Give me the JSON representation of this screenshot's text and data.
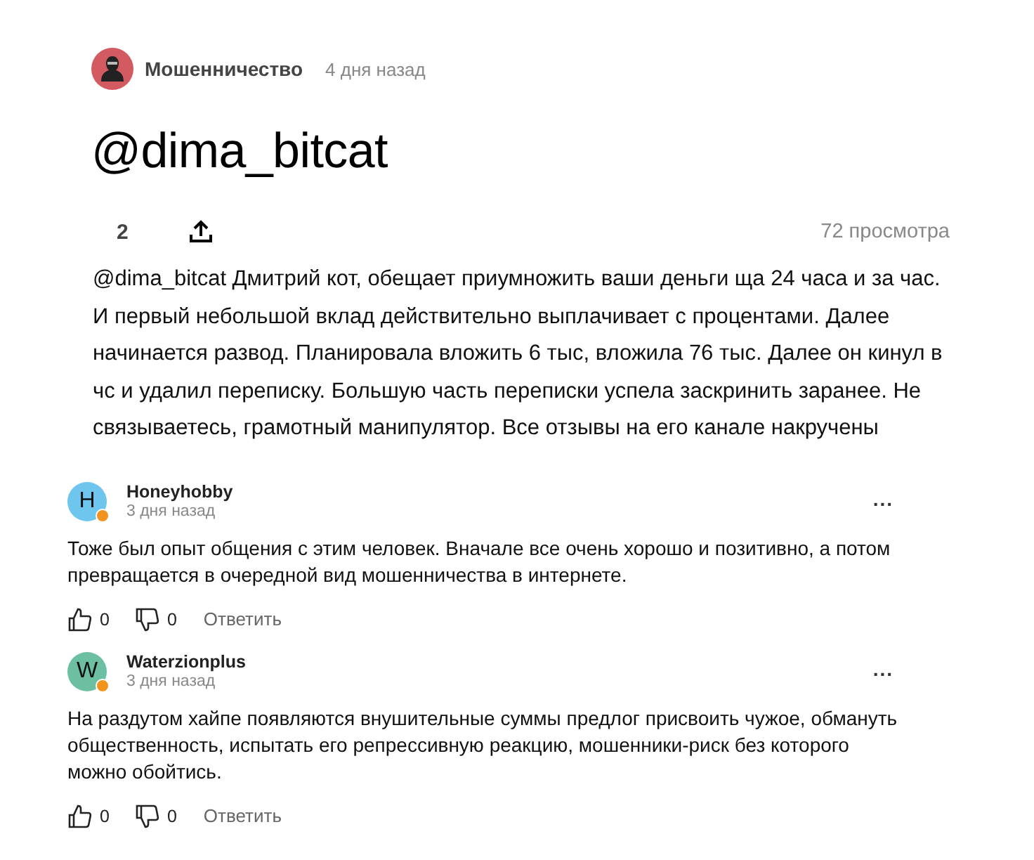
{
  "post": {
    "channel": "Мошенничество",
    "time": "4 дня назад",
    "title": "@dima_bitcat",
    "likes": "2",
    "views": "72 просмотра",
    "body": "@dima_bitcat Дмитрий кот, обещает приумножить ваши деньги ща 24 часа и за час. И первый небольшой вклад действительно выплачивает с процентами. Далее начинается развод. Планировала вложить 6 тыс, вложила 76 тыс. Далее он кинул в чс и удалил переписку. Большую часть переписки успела заскринить заранее. Не связываетесь, грамотный манипулятор. Все отзывы на его канале накручены"
  },
  "comments": [
    {
      "initial": "H",
      "color": "#6ec6ef",
      "online": true,
      "author": "Honeyhobby",
      "time": "3 дня назад",
      "text": "Тоже был опыт общения с этим человек. Вначале все очень хорошо и позитивно, а потом превращается в очередной вид мошенничества в интернете.",
      "likes": "0",
      "dislikes": "0",
      "reply": "Ответить",
      "more": "..."
    },
    {
      "initial": "W",
      "color": "#6dbfa2",
      "online": true,
      "author": "Waterzionplus",
      "time": "3 дня назад",
      "text": "На раздутом хайпе появляются внушительные суммы предлог присвоить чужое, обмануть общественность, испытать его репрессивную реакцию, мошенники-риск без которого можно обойтись.",
      "likes": "0",
      "dislikes": "0",
      "reply": "Ответить",
      "more": "..."
    }
  ]
}
